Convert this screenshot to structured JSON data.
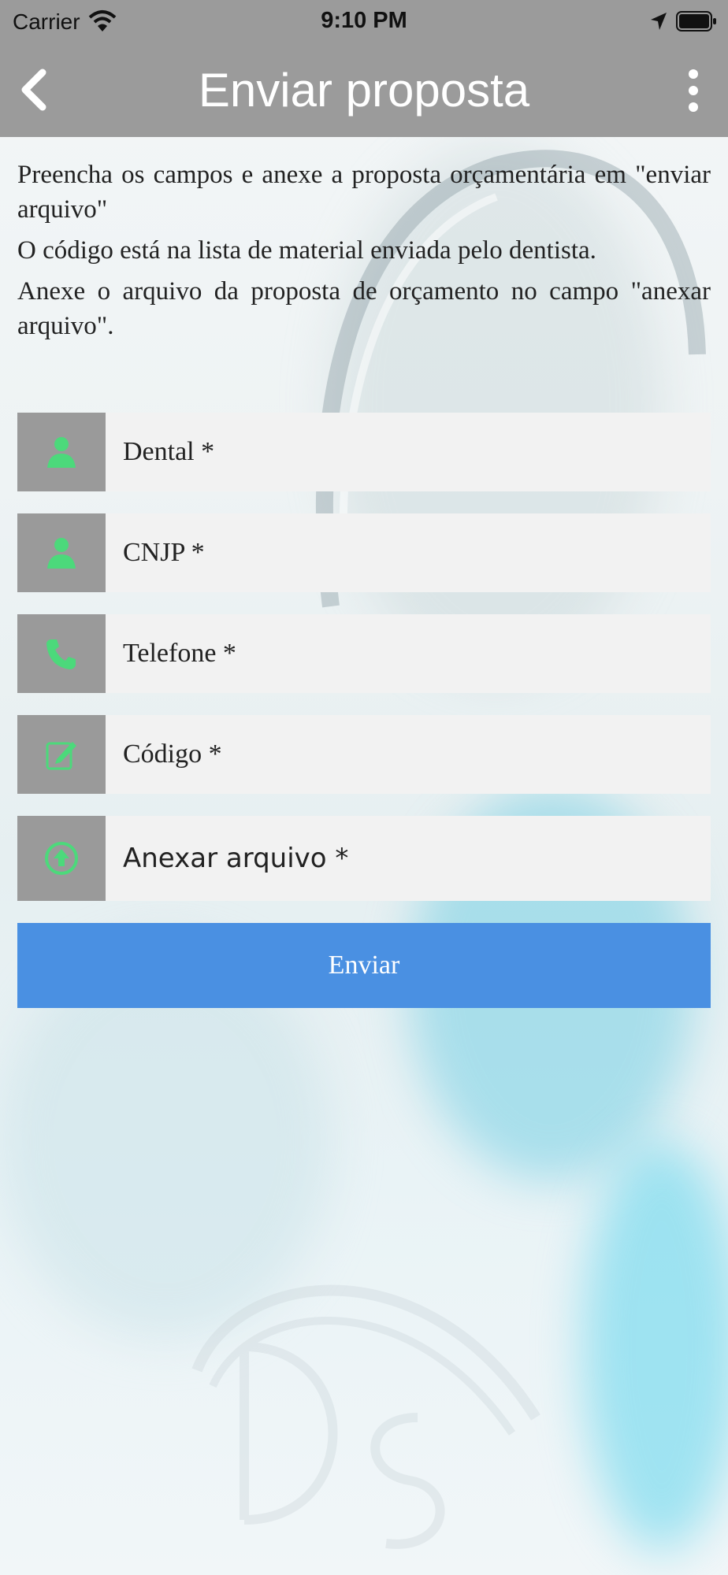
{
  "status_bar": {
    "carrier": "Carrier",
    "time": "9:10 PM"
  },
  "header": {
    "title": "Enviar proposta",
    "back_icon": "chevron-left-icon",
    "menu_icon": "more-vertical-icon"
  },
  "intro": {
    "paragraphs": [
      "Preencha os campos e anexe a proposta orçamentária em \"enviar arquivo\"",
      "O código está na lista de material enviada pelo dentista.",
      "Anexe o arquivo da proposta de orçamento no campo \"anexar arquivo\"."
    ]
  },
  "form": {
    "fields": [
      {
        "placeholder": "Dental *",
        "value": "",
        "icon": "person-icon"
      },
      {
        "placeholder": "CNJP *",
        "value": "",
        "icon": "person-icon"
      },
      {
        "placeholder": "Telefone *",
        "value": "",
        "icon": "phone-icon"
      },
      {
        "placeholder": "Código *",
        "value": "",
        "icon": "edit-icon"
      }
    ],
    "attach": {
      "label": "Anexar arquivo *",
      "icon": "upload-icon"
    },
    "submit_label": "Enviar"
  },
  "colors": {
    "bar": "#9b9b9b",
    "icon_green": "#4cd97b",
    "submit_blue": "#4a90e2",
    "field_bg": "#f2f2f2"
  }
}
